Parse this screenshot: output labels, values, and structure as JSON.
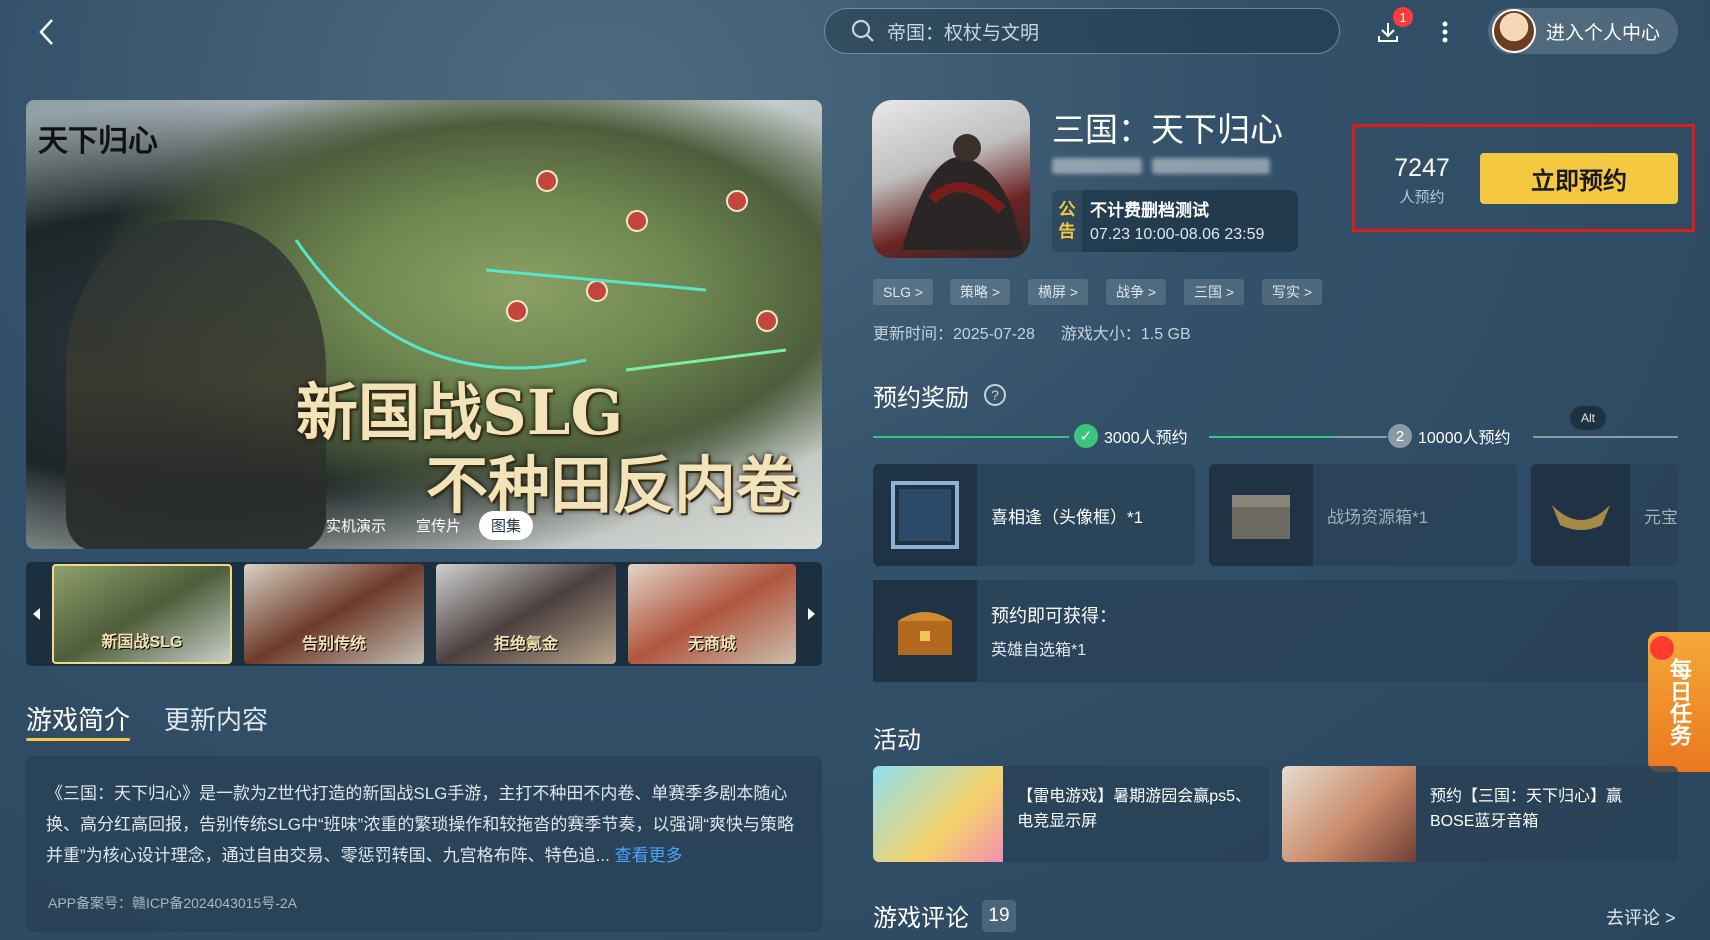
{
  "search": {
    "placeholder": "帝国：权杖与文明"
  },
  "header": {
    "download_badge": "1",
    "user_center": "进入个人中心"
  },
  "banner": {
    "logo": "天下归心",
    "headline1": "新国战SLG",
    "headline2": "不种田反内卷",
    "media_tabs": [
      "实机演示",
      "宣传片",
      "图集"
    ],
    "active_tab": "图集"
  },
  "thumbnails": [
    {
      "caption": "新国战SLG"
    },
    {
      "caption": "告别传统"
    },
    {
      "caption": "拒绝氪金"
    },
    {
      "caption": "无商城"
    }
  ],
  "intro": {
    "tabs": [
      "游戏简介",
      "更新内容"
    ],
    "text": "《三国：天下归心》是一款为Z世代打造的新国战SLG手游，主打不种田不内卷、单赛季多剧本随心换、高分红高回报，告别传统SLG中“班味”浓重的繁琐操作和较拖沓的赛季节奏，以强调“爽快与策略并重”为核心设计理念，通过自由交易、零惩罚转国、九宫格布阵、特色追...",
    "see_more": "查看更多",
    "icp": "APP备案号：赣ICP备2024043015号-2A"
  },
  "game": {
    "title": "三国：天下归心",
    "notice_tag": [
      "公",
      "告"
    ],
    "notice_title": "不计费删档测试",
    "notice_time": "07.23 10:00-08.06 23:59",
    "reserve_count": "7247",
    "reserve_label": "人预约",
    "reserve_button": "立即预约",
    "tags": [
      "SLG >",
      "策略 >",
      "横屏 >",
      "战争 >",
      "三国 >",
      "写实 >"
    ],
    "update_time": "更新时间：2025-07-28",
    "size": "游戏大小：1.5 GB"
  },
  "rewards": {
    "title": "预约奖励",
    "help": "?",
    "milestones": [
      {
        "label": "3000人预约",
        "marker": "✓",
        "done": true
      },
      {
        "label": "10000人预约",
        "marker": "2",
        "done": false
      }
    ],
    "alt_badge": "Alt",
    "items": [
      {
        "name": "喜相逢（头像框）*1"
      },
      {
        "name": "战场资源箱*1"
      },
      {
        "name": "元宝"
      }
    ],
    "gift_line1": "预约即可获得：",
    "gift_line2": "英雄自选箱*1",
    "daily_task": "每日任务"
  },
  "activities": {
    "title": "活动",
    "items": [
      {
        "text": "【雷电游戏】暑期游园会赢ps5、电竞显示屏"
      },
      {
        "text": "预约【三国：天下归心】赢BOSE蓝牙音箱"
      }
    ]
  },
  "reviews": {
    "title": "游戏评论",
    "count": "19",
    "go": "去评论 >"
  },
  "colors": {
    "accent": "#f5c842",
    "highlight_border": "#e01b1b",
    "progress": "#3ac47d",
    "link": "#4aa3ff"
  }
}
